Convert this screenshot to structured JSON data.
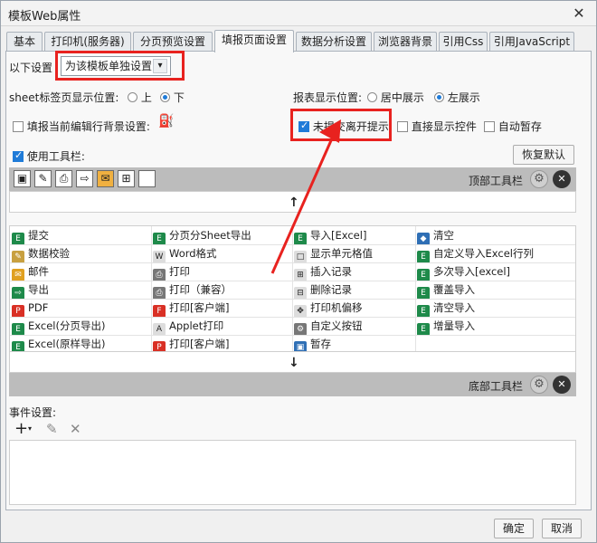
{
  "window": {
    "title": "模板Web属性",
    "close": "✕"
  },
  "tabs": [
    "基本",
    "打印机(服务器)",
    "分页预览设置",
    "填报页面设置",
    "数据分析设置",
    "浏览器背景",
    "引用Css",
    "引用JavaScript"
  ],
  "settings": {
    "mode_label": "以下设置",
    "mode_value": "为该模板单独设置",
    "sheet_pos_label": "sheet标签页显示位置:",
    "sheet_top": "上",
    "sheet_bottom": "下",
    "report_pos_label": "报表显示位置:",
    "report_center": "居中展示",
    "report_left": "左展示",
    "fill_bg_label": "填报当前编辑行背景设置:",
    "unsaved_prompt": "未提交离开提示",
    "show_controls": "直接显示控件",
    "auto_save": "自动暂存",
    "use_toolbar": "使用工具栏:",
    "restore_default": "恢复默认"
  },
  "top_toolbar_label": "顶部工具栏",
  "bottom_toolbar_label": "底部工具栏",
  "up_arrow": "↑",
  "down_arrow": "↓",
  "buttons": [
    [
      "提交",
      "分页分Sheet导出",
      "导入[Excel]",
      "清空"
    ],
    [
      "数据校验",
      "Word格式",
      "显示单元格值",
      "自定义导入Excel行列"
    ],
    [
      "邮件",
      "打印",
      "插入记录",
      "多次导入[excel]"
    ],
    [
      "导出",
      "打印（兼容）",
      "删除记录",
      "覆盖导入"
    ],
    [
      "PDF",
      "打印[客户端]",
      "打印机偏移",
      "清空导入"
    ],
    [
      "Excel(分页导出)",
      "Applet打印",
      "自定义按钮",
      "增量导入"
    ],
    [
      "Excel(原样导出)",
      "打印[客户端]",
      "暂存",
      ""
    ]
  ],
  "event_label": "事件设置:",
  "ok": "确定",
  "cancel": "取消"
}
